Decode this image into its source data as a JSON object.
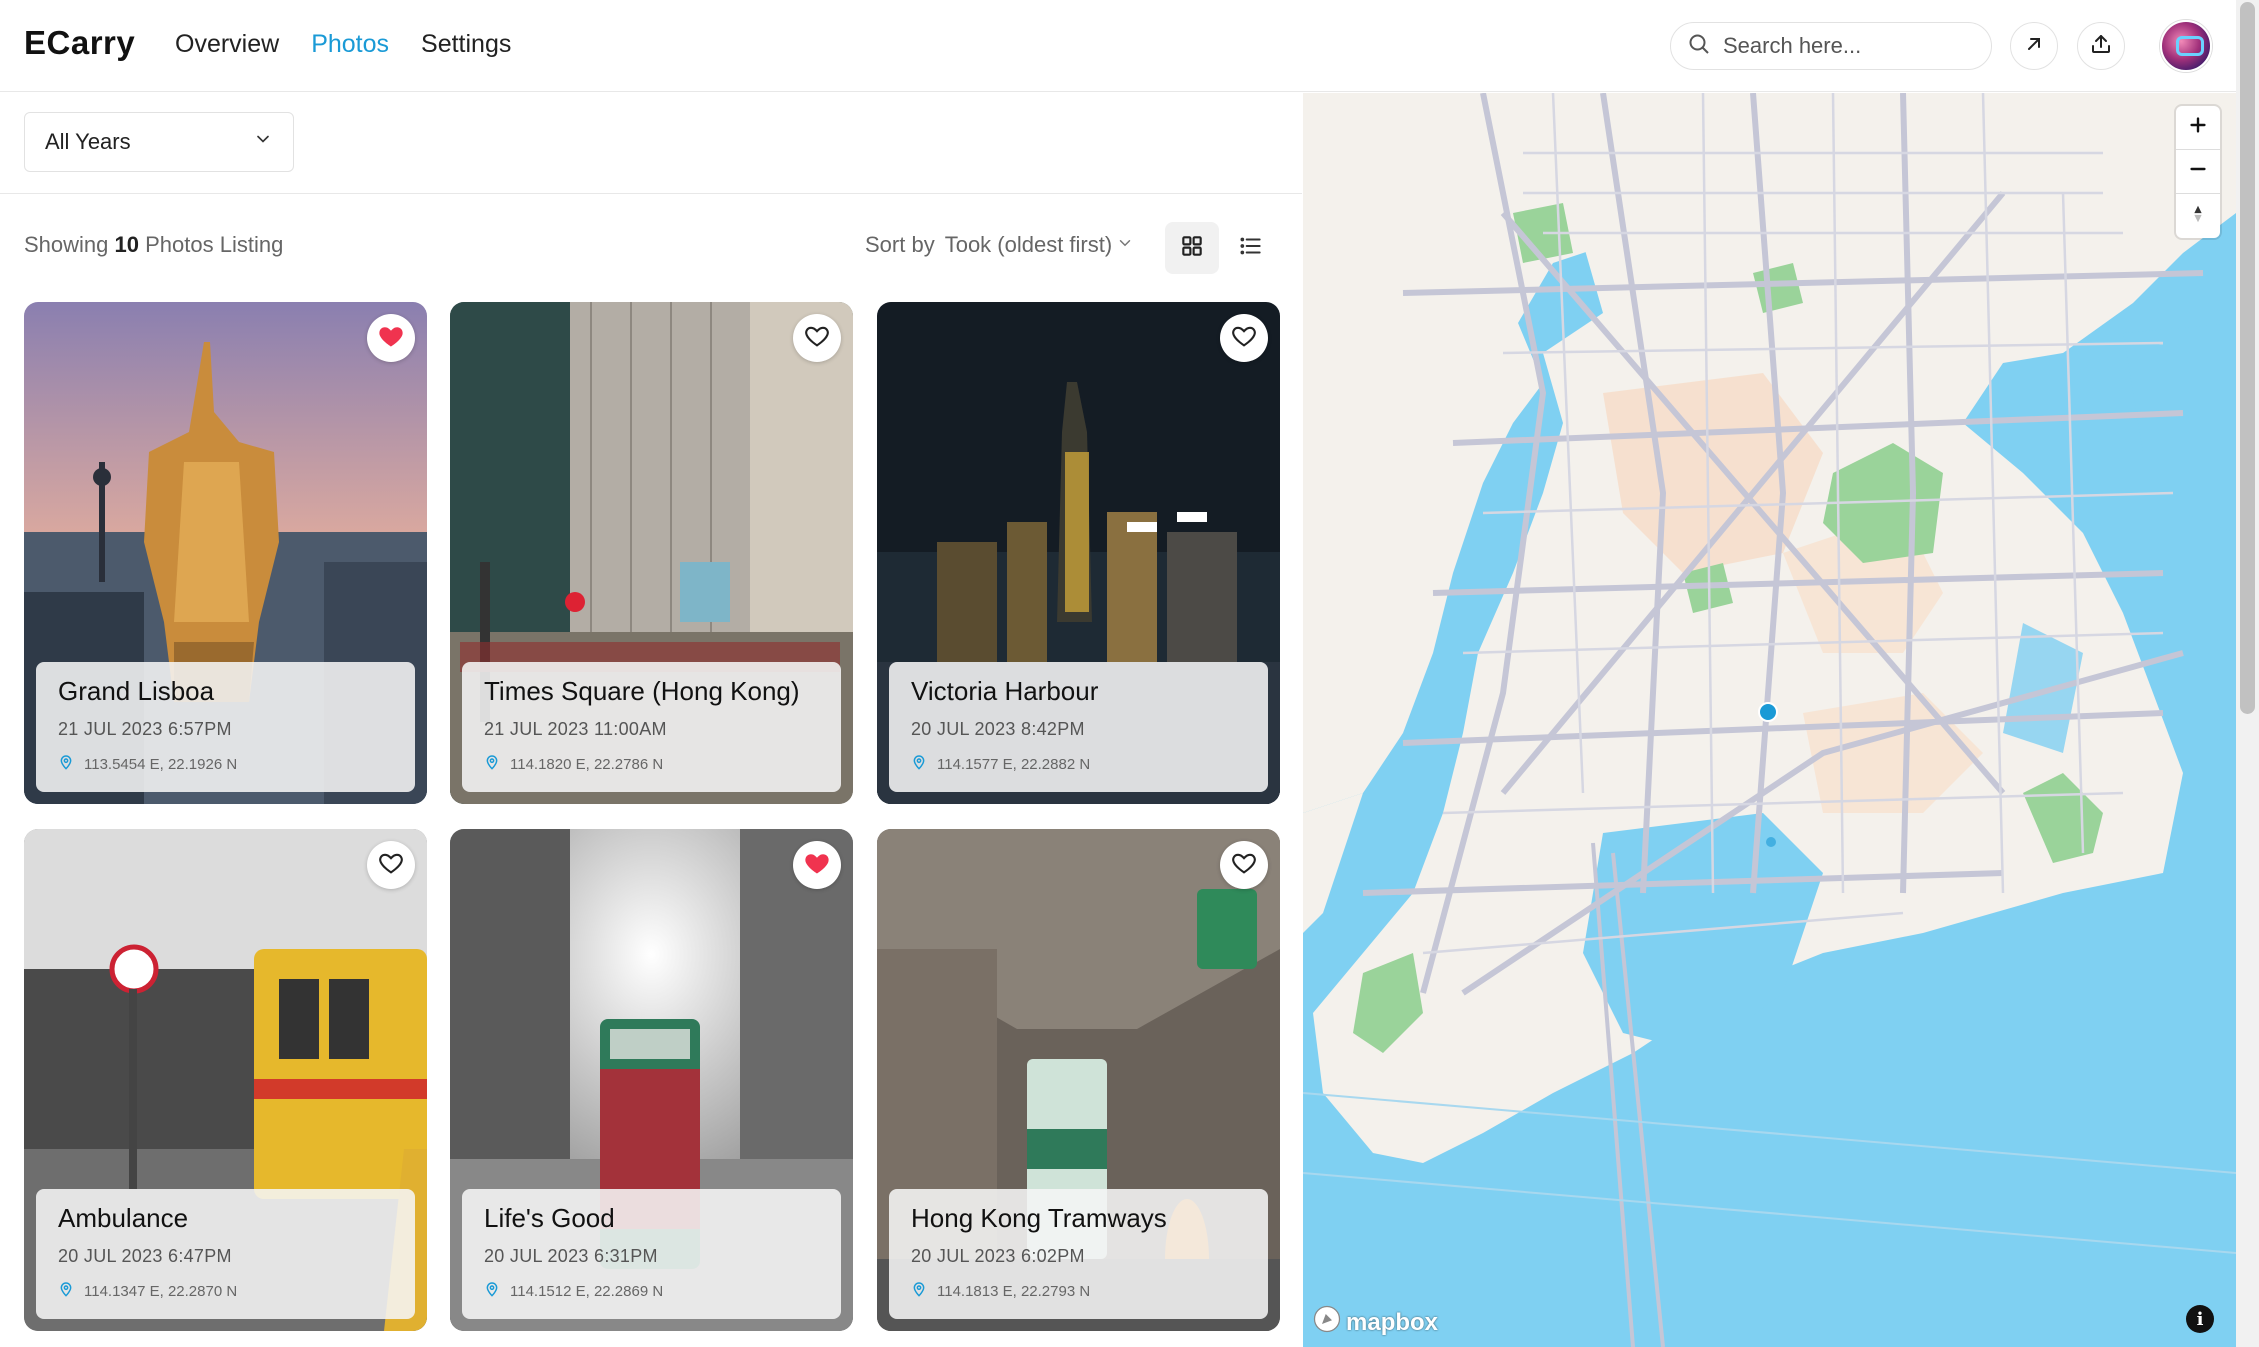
{
  "header": {
    "logo": "ECarry",
    "nav": [
      {
        "label": "Overview",
        "active": false
      },
      {
        "label": "Photos",
        "active": true
      },
      {
        "label": "Settings",
        "active": false
      }
    ],
    "search_placeholder": "Search here...",
    "accent_color": "#1a9ad6"
  },
  "filters": {
    "year_select": "All Years"
  },
  "listing": {
    "prefix": "Showing",
    "count": "10",
    "suffix": "Photos Listing",
    "sort_label": "Sort by",
    "sort_value": "Took (oldest first)",
    "view_modes": [
      "grid",
      "list"
    ],
    "active_view": "grid"
  },
  "photos": [
    {
      "title": "Grand Lisboa",
      "date": "21 JUL 2023 6:57PM",
      "coords": "113.5454 E, 22.1926 N",
      "liked": true
    },
    {
      "title": "Times Square (Hong Kong)",
      "date": "21 JUL 2023 11:00AM",
      "coords": "114.1820 E, 22.2786 N",
      "liked": false
    },
    {
      "title": "Victoria Harbour",
      "date": "20 JUL 2023 8:42PM",
      "coords": "114.1577 E, 22.2882 N",
      "liked": false
    },
    {
      "title": "Ambulance",
      "date": "20 JUL 2023 6:47PM",
      "coords": "114.1347 E, 22.2870 N",
      "liked": false
    },
    {
      "title": "Life's Good",
      "date": "20 JUL 2023 6:31PM",
      "coords": "114.1512 E, 22.2869 N",
      "liked": true
    },
    {
      "title": "Hong Kong Tramways",
      "date": "20 JUL 2023 6:02PM",
      "coords": "114.1813 E, 22.2793 N",
      "liked": false
    }
  ],
  "map": {
    "attribution": "mapbox",
    "info_label": "i",
    "controls": [
      "zoom-in",
      "zoom-out",
      "compass"
    ],
    "water_color": "#7fd0f2",
    "land_color": "#f4f1ec",
    "marker_color": "#1a9ad6"
  },
  "colors": {
    "heart_liked": "#f0334f"
  }
}
